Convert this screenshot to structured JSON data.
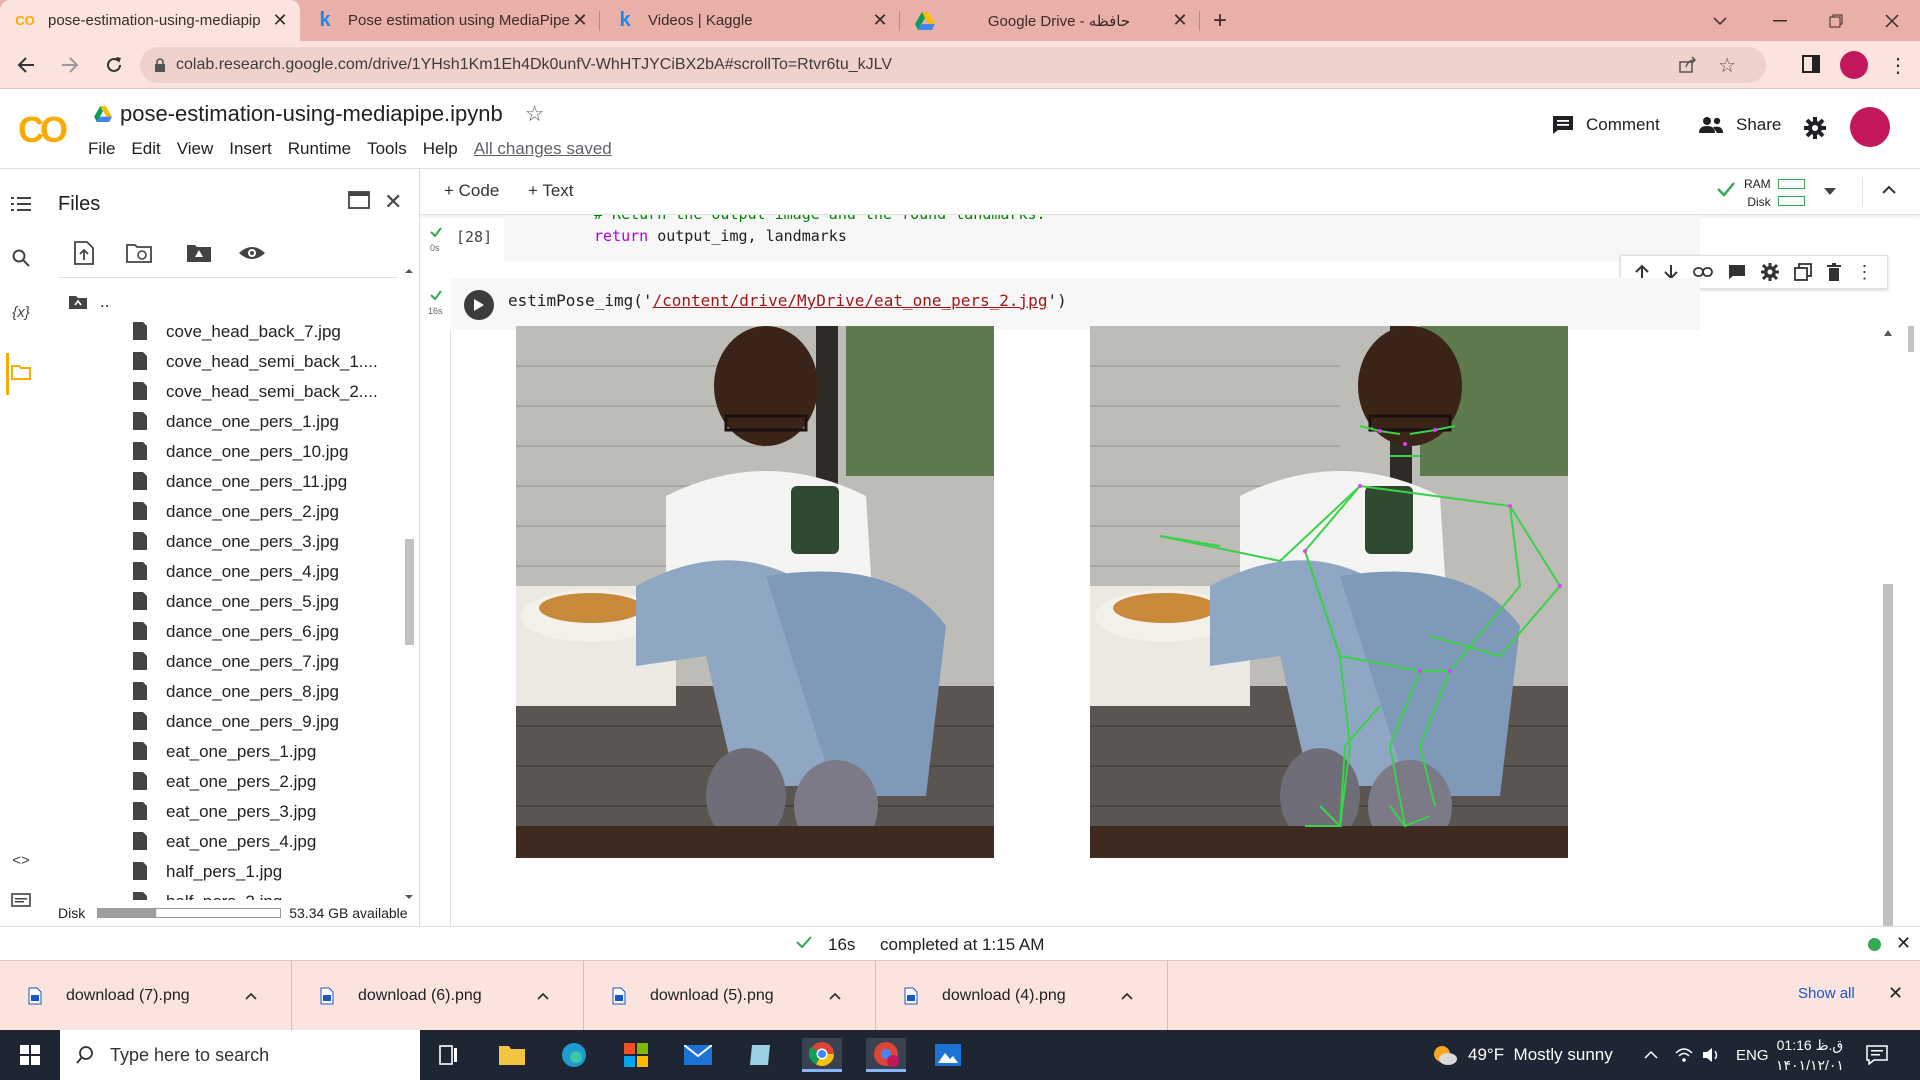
{
  "browser": {
    "tabs": [
      {
        "title": "pose-estimation-using-mediapip",
        "favicon": "colab-icon",
        "active": true
      },
      {
        "title": "Pose estimation using MediaPipe",
        "favicon": "kaggle-icon",
        "active": false
      },
      {
        "title": "Videos | Kaggle",
        "favicon": "kaggle-icon",
        "active": false
      },
      {
        "title": "Google Drive - حافظه",
        "favicon": "drive-icon",
        "active": false
      }
    ],
    "url": "colab.research.google.com/drive/1YHsh1Km1Eh4Dk0unfV-WhHTJYCiBX2bA#scrollTo=Rtvr6tu_kJLV"
  },
  "colab": {
    "logo": "CO",
    "notebook_title": "pose-estimation-using-mediapipe.ipynb",
    "menu": [
      "File",
      "Edit",
      "View",
      "Insert",
      "Runtime",
      "Tools",
      "Help"
    ],
    "save_status": "All changes saved",
    "comment_label": "Comment",
    "share_label": "Share",
    "ram_label": "RAM",
    "disk_label": "Disk"
  },
  "sidebar": {
    "title": "Files",
    "parent": "..",
    "files": [
      "cove_head_back_7.jpg",
      "cove_head_semi_back_1....",
      "cove_head_semi_back_2....",
      "dance_one_pers_1.jpg",
      "dance_one_pers_10.jpg",
      "dance_one_pers_11.jpg",
      "dance_one_pers_2.jpg",
      "dance_one_pers_3.jpg",
      "dance_one_pers_4.jpg",
      "dance_one_pers_5.jpg",
      "dance_one_pers_6.jpg",
      "dance_one_pers_7.jpg",
      "dance_one_pers_8.jpg",
      "dance_one_pers_9.jpg",
      "eat_one_pers_1.jpg",
      "eat_one_pers_2.jpg",
      "eat_one_pers_3.jpg",
      "eat_one_pers_4.jpg",
      "half_pers_1.jpg",
      "half_pers_2.jpg"
    ],
    "disk_label": "Disk",
    "disk_available": "53.34 GB available",
    "disk_used_fraction": 0.32
  },
  "notebook": {
    "add_code": "+ Code",
    "add_text": "+ Text",
    "cell1": {
      "exec_count": "[28]",
      "time": "0s",
      "comment": "# Return the output image and the found landmarks.",
      "kw": "return",
      "rest": " output_img, landmarks"
    },
    "cell2": {
      "time": "16s",
      "code_prefix": "estimPose_img('",
      "code_string": "/content/drive/MyDrive/eat_one_pers_2.jpg",
      "code_suffix": "')"
    }
  },
  "status": {
    "duration": "16s",
    "completed": "completed at 1:15 AM"
  },
  "downloads": {
    "items": [
      "download (7).png",
      "download (6).png",
      "download (5).png",
      "download (4).png"
    ],
    "show_all": "Show all"
  },
  "taskbar": {
    "search_placeholder": "Type here to search",
    "weather": "49°F  Mostly sunny",
    "lang": "ENG",
    "time": "01:16 ق.ظ",
    "date": "۱۴۰۱/۱۲/۰۱"
  },
  "colors": {
    "tab_strip": "#e8b0a8",
    "toolbar": "#fbe3de",
    "colab_orange": "#f9ab00",
    "pose_line": "#3cd14a",
    "check_green": "#34a853"
  }
}
